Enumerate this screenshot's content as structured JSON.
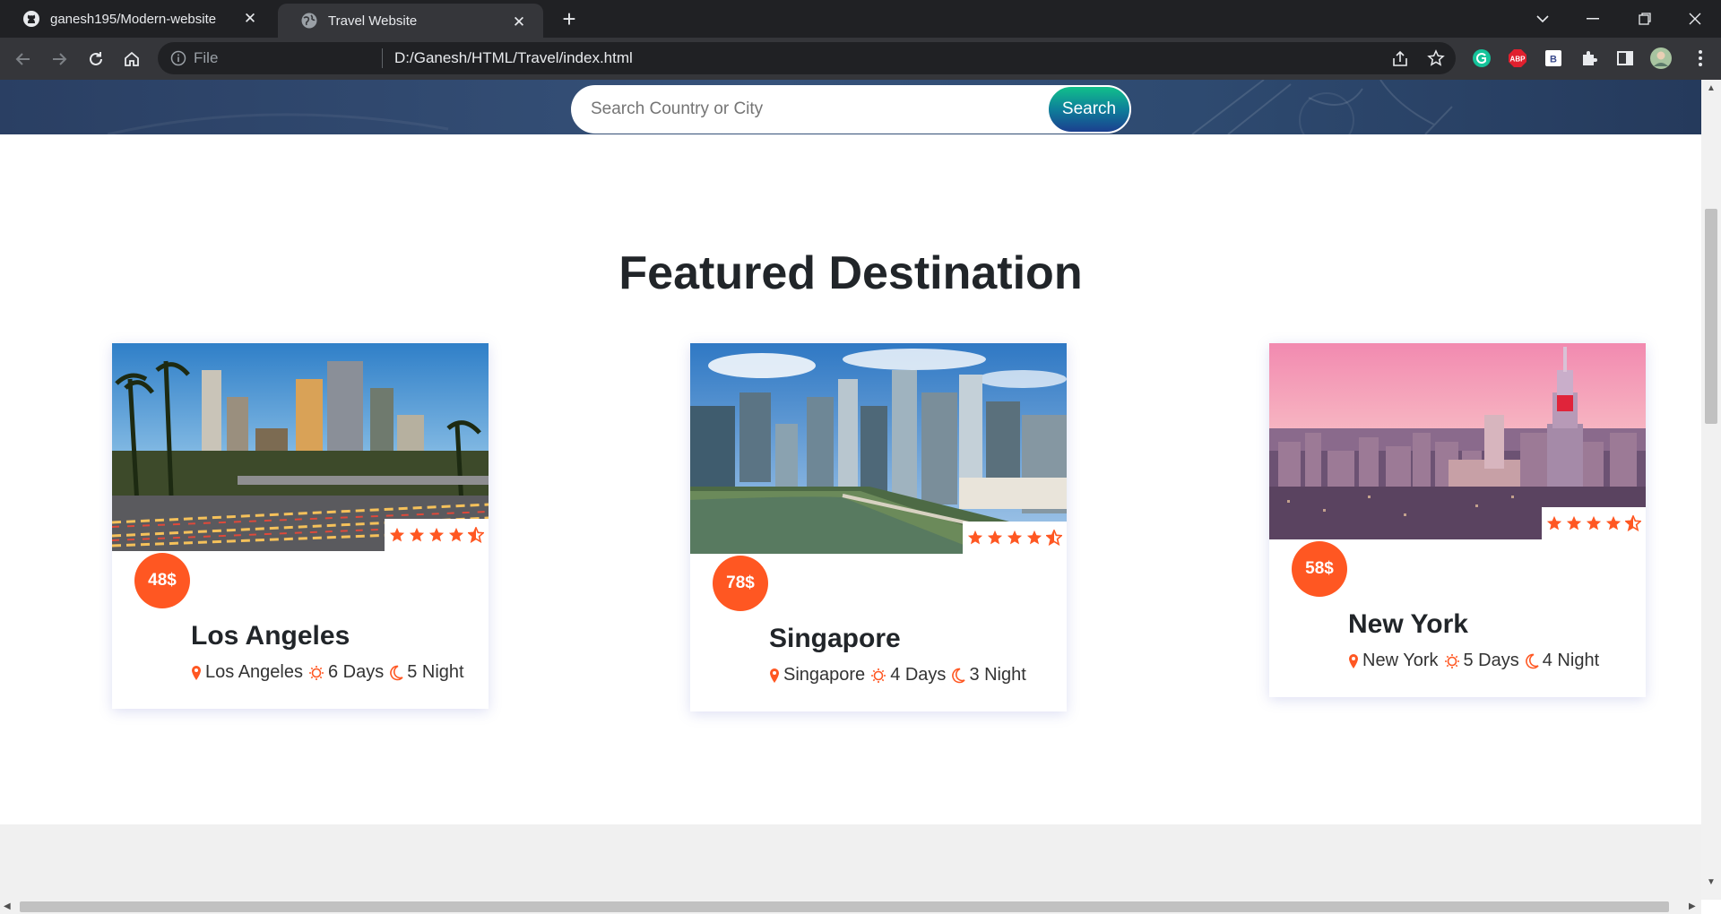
{
  "browser": {
    "tabs": [
      {
        "title": "ganesh195/Modern-website",
        "icon": "github-icon",
        "active": false
      },
      {
        "title": "Travel Website",
        "icon": "globe-icon",
        "active": true
      }
    ],
    "address": {
      "scheme": "File",
      "url": "D:/Ganesh/HTML/Travel/index.html"
    },
    "extensions": [
      "grammarly-icon",
      "adblock-plus-icon",
      "bookmark-ext-icon",
      "puzzle-icon",
      "sidepanel-icon",
      "profile-avatar"
    ]
  },
  "search": {
    "placeholder": "Search Country or City",
    "button_label": "Search"
  },
  "section": {
    "title": "Featured Destination"
  },
  "colors": {
    "accent": "#ff5722",
    "hero": "#2e4a70",
    "search_gradient_top": "#11c08a",
    "search_gradient_bottom": "#1b3f8f"
  },
  "destinations": [
    {
      "name": "Los Angeles",
      "price": "48$",
      "location": "Los Angeles",
      "days": "6 Days",
      "nights": "5 Night",
      "rating": 4.5,
      "image": "los-angeles-skyline"
    },
    {
      "name": "Singapore",
      "price": "78$",
      "location": "Singapore",
      "days": "4 Days",
      "nights": "3 Night",
      "rating": 4.5,
      "image": "singapore-skyline"
    },
    {
      "name": "New York",
      "price": "58$",
      "location": "New York",
      "days": "5 Days",
      "nights": "4 Night",
      "rating": 4.5,
      "image": "new-york-skyline"
    }
  ]
}
